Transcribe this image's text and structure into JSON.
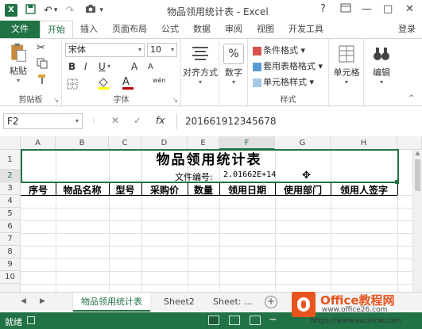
{
  "window": {
    "title": "物品领用统计表 - Excel",
    "help": "?",
    "restore_icon": "ribbon-display-icon",
    "minimize": "—",
    "maximize": "□",
    "close": "✕"
  },
  "qat": {
    "app_icon": "X",
    "save_icon": "save-icon",
    "undo_icon": "undo-icon",
    "redo_icon": "redo-icon",
    "camera_icon": "camera-icon",
    "more": "▾"
  },
  "tabs": [
    "文件",
    "开始",
    "插入",
    "页面布局",
    "公式",
    "数据",
    "审阅",
    "视图",
    "开发工具"
  ],
  "login": "登录",
  "ribbon": {
    "clipboard": {
      "paste": "粘贴",
      "group": "剪贴板"
    },
    "font": {
      "name": "宋体",
      "size": "10",
      "bold": "B",
      "italic": "I",
      "underline": "U",
      "grow": "A",
      "shrink": "A",
      "phonetic": "wén",
      "group": "字体"
    },
    "alignment": {
      "label": "对齐方式"
    },
    "number": {
      "label": "数字",
      "symbol": "%"
    },
    "styles": {
      "conditional": "条件格式",
      "table": "套用表格格式",
      "cell": "单元格样式",
      "group": "样式"
    },
    "cells": {
      "label": "单元格"
    },
    "editing": {
      "label": "编辑"
    }
  },
  "formula_bar": {
    "name_box": "F2",
    "cancel": "✕",
    "confirm": "✓",
    "fx": "fx",
    "value": "201661912345678"
  },
  "grid": {
    "columns": [
      "A",
      "B",
      "C",
      "D",
      "E",
      "F",
      "G",
      "H"
    ],
    "selected_column": "F",
    "rows": [
      "1",
      "2",
      "3",
      "4",
      "5",
      "6",
      "7",
      "8",
      "9",
      "10"
    ],
    "selected_row": "2",
    "title": "物品领用统计表",
    "file_no_label": "文件编号:",
    "file_no_value": "2.01662E+14",
    "headers": [
      "序号",
      "物品名称",
      "型号",
      "采购价",
      "数量",
      "领用日期",
      "使用部门",
      "领用人签字"
    ]
  },
  "sheets": {
    "tabs": [
      "物品领用统计表",
      "Sheet2",
      "Sheet: ..."
    ],
    "active": 0,
    "add": "+"
  },
  "status": {
    "ready": "就绪"
  },
  "watermark": {
    "brand": "Office教程网",
    "url1": "www.office26.com",
    "url2": "https://www.excelcw.com"
  },
  "colors": {
    "accent": "#217346",
    "watermark_orange": "#e8541e"
  }
}
